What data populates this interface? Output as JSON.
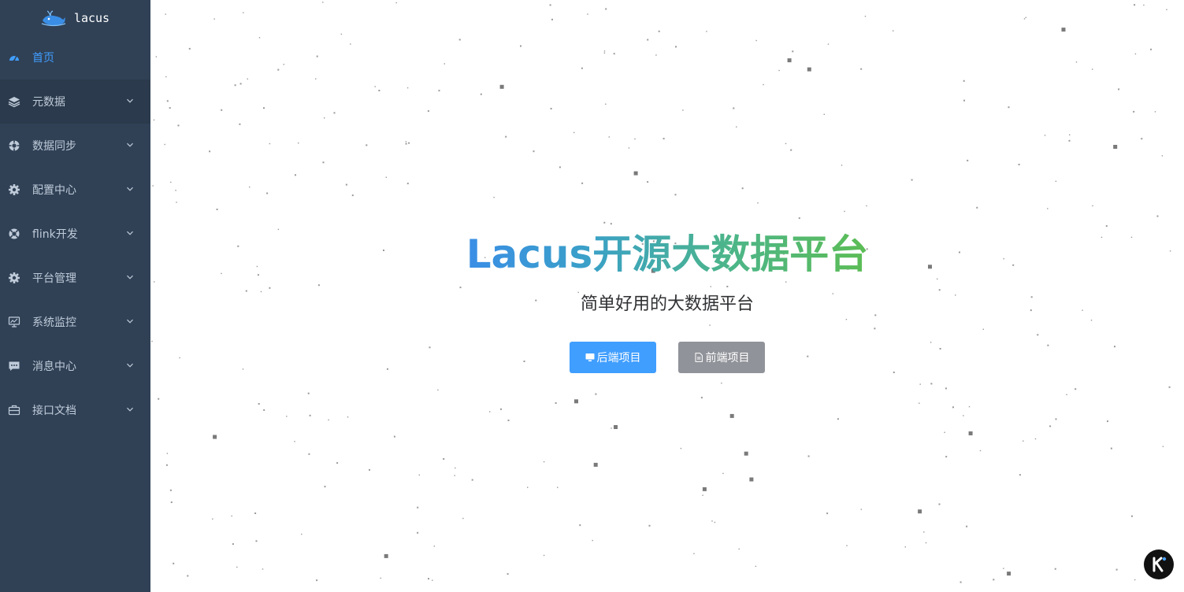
{
  "app": {
    "logo_text": "lacus"
  },
  "sidebar": {
    "items": [
      {
        "label": "首页",
        "icon": "dashboard-icon",
        "active": true,
        "has_children": false
      },
      {
        "label": "元数据",
        "icon": "layers-icon",
        "active": false,
        "has_children": true
      },
      {
        "label": "数据同步",
        "icon": "sync-icon",
        "active": false,
        "has_children": true
      },
      {
        "label": "配置中心",
        "icon": "gear-icon",
        "active": false,
        "has_children": true
      },
      {
        "label": "flink开发",
        "icon": "lifebuoy-icon",
        "active": false,
        "has_children": true
      },
      {
        "label": "平台管理",
        "icon": "gear-icon",
        "active": false,
        "has_children": true
      },
      {
        "label": "系统监控",
        "icon": "monitor-icon",
        "active": false,
        "has_children": true
      },
      {
        "label": "消息中心",
        "icon": "message-icon",
        "active": false,
        "has_children": true
      },
      {
        "label": "接口文档",
        "icon": "briefcase-icon",
        "active": false,
        "has_children": true
      }
    ]
  },
  "hero": {
    "title": "Lacus开源大数据平台",
    "subtitle": "简单好用的大数据平台",
    "backend_button": "后端项目",
    "frontend_button": "前端项目"
  },
  "colors": {
    "sidebar_bg": "#304156",
    "active": "#409eff",
    "primary_button": "#409eff",
    "secondary_button": "#909399"
  }
}
